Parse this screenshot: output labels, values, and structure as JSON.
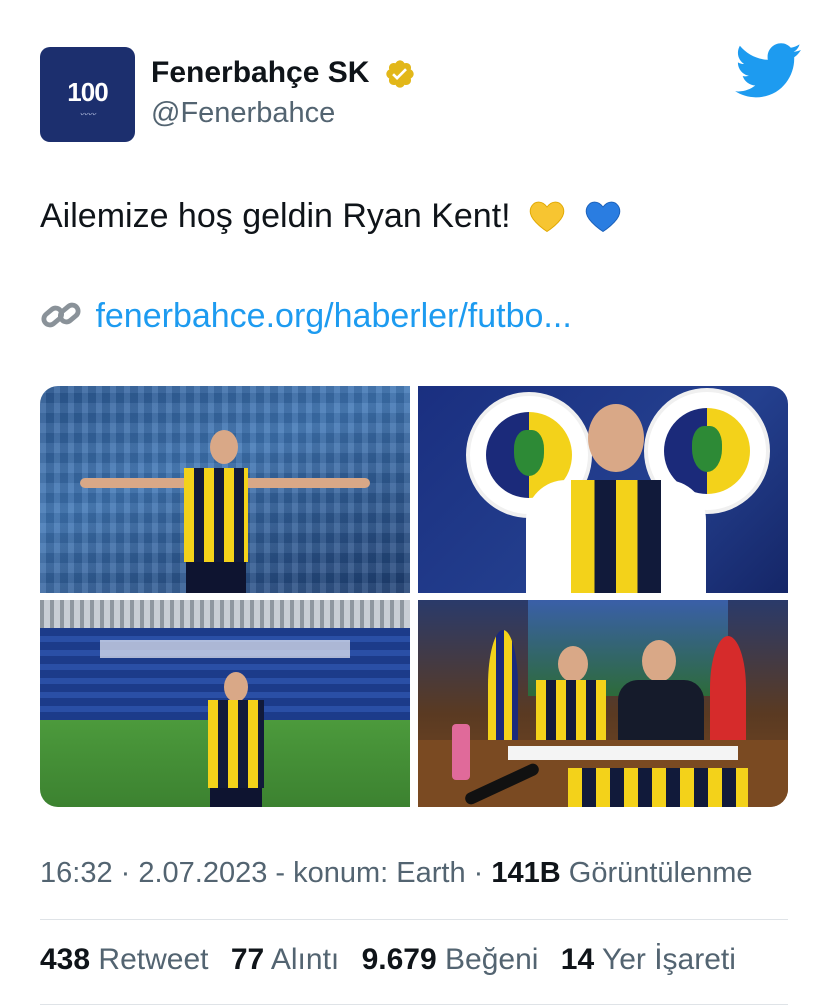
{
  "account": {
    "name": "Fenerbahçe SK",
    "handle": "@Fenerbahce",
    "avatar_text": "100",
    "avatar_icon": "fenerbahce-100-logo",
    "verified_icon": "verified-gold-badge-icon"
  },
  "platform_icon": "twitter-bird-icon",
  "tweet": {
    "text": "Ailemize hoş geldin Ryan Kent!",
    "emojis": [
      "yellow-heart",
      "blue-heart"
    ],
    "link_icon": "link-icon",
    "link_text": "fenerbahce.org/haberler/futbo..."
  },
  "media": [
    {
      "name": "photo-stadium-crowd-wall"
    },
    {
      "name": "photo-club-crest-portrait"
    },
    {
      "name": "photo-stadium-pitch"
    },
    {
      "name": "photo-contract-signing"
    }
  ],
  "meta": {
    "time_date": "16:32 · 2.07.2023 - konum: Earth ·",
    "views_count": "141B",
    "views_label": "Görüntülenme"
  },
  "stats": {
    "retweets": {
      "count": "438",
      "label": "Retweet"
    },
    "quotes": {
      "count": "77",
      "label": "Alıntı"
    },
    "likes": {
      "count": "9.679",
      "label": "Beğeni"
    },
    "bookmarks": {
      "count": "14",
      "label": "Yer İşareti"
    }
  },
  "colors": {
    "link": "#1d9bf0",
    "secondary_text": "#536471",
    "verified_gold": "#e2b719",
    "avatar_bg": "#1c2f6e"
  }
}
